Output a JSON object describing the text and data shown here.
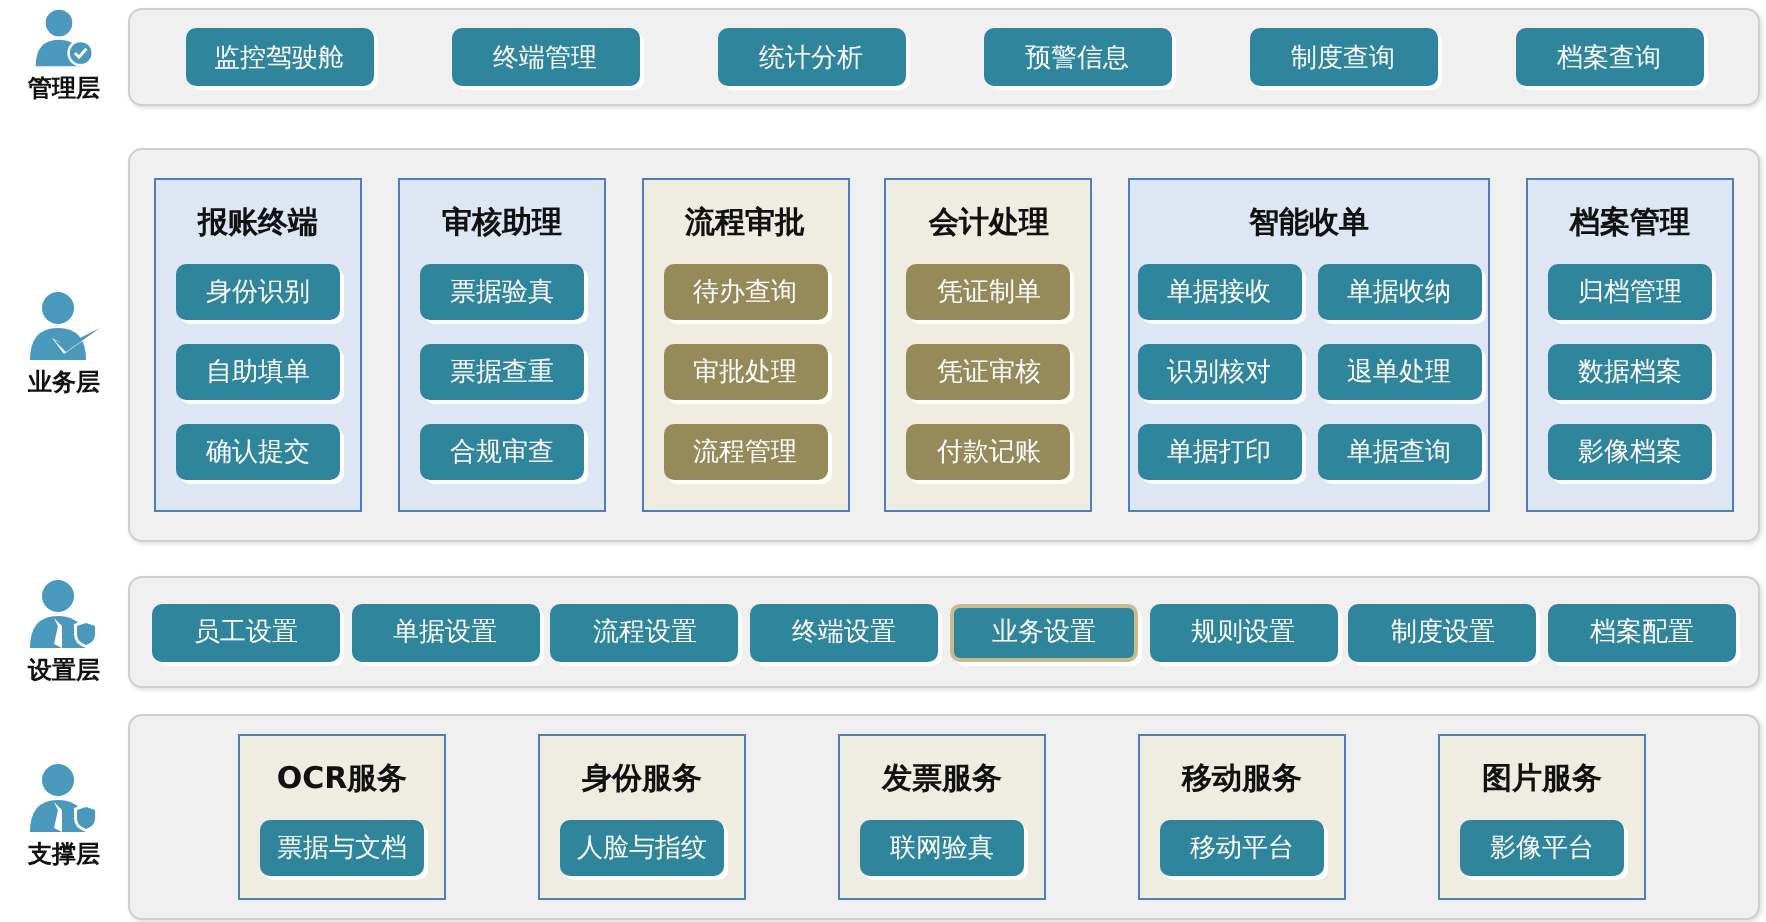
{
  "layers": [
    {
      "label": "管理层",
      "kind": "buttons",
      "buttons": [
        {
          "label": "监控驾驶舱",
          "selected": false
        },
        {
          "label": "终端管理",
          "selected": false
        },
        {
          "label": "统计分析",
          "selected": false
        },
        {
          "label": "预警信息",
          "selected": false
        },
        {
          "label": "制度查询",
          "selected": false
        },
        {
          "label": "档案查询",
          "selected": false
        }
      ]
    },
    {
      "label": "业务层",
      "kind": "modules",
      "modules": [
        {
          "title": "报账终端",
          "kind": "blue",
          "buttons": [
            "身份识别",
            "自助填单",
            "确认提交"
          ]
        },
        {
          "title": "审核助理",
          "kind": "blue",
          "buttons": [
            "票据验真",
            "票据查重",
            "合规审查"
          ]
        },
        {
          "title": "流程审批",
          "kind": "tan",
          "buttons": [
            "待办查询",
            "审批处理",
            "流程管理"
          ]
        },
        {
          "title": "会计处理",
          "kind": "tan",
          "buttons": [
            "凭证制单",
            "凭证审核",
            "付款记账"
          ]
        },
        {
          "title": "智能收单",
          "kind": "blue",
          "buttons": [
            "单据接收",
            "单据收纳",
            "识别核对",
            "退单处理",
            "单据打印",
            "单据查询"
          ]
        },
        {
          "title": "档案管理",
          "kind": "blue",
          "buttons": [
            "归档管理",
            "数据档案",
            "影像档案"
          ]
        }
      ]
    },
    {
      "label": "设置层",
      "kind": "buttons",
      "buttons": [
        {
          "label": "员工设置",
          "selected": false
        },
        {
          "label": "单据设置",
          "selected": false
        },
        {
          "label": "流程设置",
          "selected": false
        },
        {
          "label": "终端设置",
          "selected": false
        },
        {
          "label": "业务设置",
          "selected": true
        },
        {
          "label": "规则设置",
          "selected": false
        },
        {
          "label": "制度设置",
          "selected": false
        },
        {
          "label": "档案配置",
          "selected": false
        }
      ]
    },
    {
      "label": "支撑层",
      "kind": "services",
      "modules": [
        {
          "title": "OCR服务",
          "kind": "cream",
          "buttons": [
            "票据与文档"
          ]
        },
        {
          "title": "身份服务",
          "kind": "cream",
          "buttons": [
            "人脸与指纹"
          ]
        },
        {
          "title": "发票服务",
          "kind": "cream",
          "buttons": [
            "联网验真"
          ]
        },
        {
          "title": "移动服务",
          "kind": "cream",
          "buttons": [
            "移动平台"
          ]
        },
        {
          "title": "图片服务",
          "kind": "cream",
          "buttons": [
            "影像平台"
          ]
        }
      ]
    }
  ]
}
